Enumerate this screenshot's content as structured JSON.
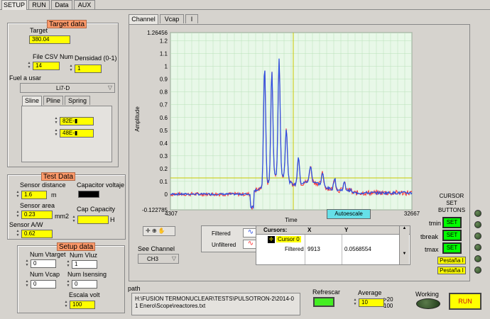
{
  "top_tabs": [
    "SETUP",
    "RUN",
    "Data",
    "AUX"
  ],
  "target": {
    "header": "Target data",
    "target_label": "Target",
    "target_value": "380.04",
    "file_label": "File CSV Num",
    "file_value": "14",
    "dens_label": "Densidad (0-1)",
    "dens_value": "1",
    "fuel_label": "Fuel a usar",
    "fuel_value": "Li7-D",
    "subtabs": [
      "Sline",
      "Pline",
      "Spring"
    ],
    "v1": "82E-▮",
    "v2": "48E-▮"
  },
  "test": {
    "header": "Test Data",
    "dist_label": "Sensor distance",
    "dist_value": "1.6",
    "dist_unit": "m",
    "cap_label": "Capacitor voltaje",
    "area_label": "Sensor area",
    "area_value": "0.23",
    "area_unit": "mm2",
    "capc_label": "Cap Capacity",
    "capc_unit": "H",
    "aw_label": "Sensor A/W",
    "aw_value": "0.62"
  },
  "setup": {
    "header": "Setup data",
    "vt_label": "Num Vtarget",
    "vt_value": "0",
    "vl_label": "Num Vluz",
    "vl_value": "1",
    "vc_label": "Num Vcap",
    "vc_value": "0",
    "is_label": "Num Isensing",
    "is_value": "0",
    "esc_label": "Escala volt",
    "esc_value": "100"
  },
  "chart_tabs": [
    "Channel",
    "Vcap",
    "I"
  ],
  "chart_data": {
    "type": "line",
    "title": "",
    "xlabel": "Time",
    "ylabel": "Amplitude",
    "xlim": [
      4307,
      32667
    ],
    "ylim": [
      -0.122785,
      1.26456
    ],
    "yticks": [
      "1.26456",
      "1.2",
      "1.1",
      "1",
      "0.9",
      "0.8",
      "0.7",
      "0.6",
      "0.5",
      "0.4",
      "0.3",
      "0.2",
      "0.1",
      "0",
      "-0.122785"
    ],
    "xticks": [
      "4307",
      "32667"
    ],
    "series": [
      {
        "name": "Filtered",
        "color": "#3050e0"
      },
      {
        "name": "Unfiltered",
        "color": "#ff3030"
      }
    ]
  },
  "autoescale": "Autoescale",
  "legend": {
    "filtered": "Filtered",
    "unfiltered": "Unfiltered"
  },
  "cursors": {
    "header": "Cursors:",
    "col_x": "X",
    "col_y": "Y",
    "name": "Cursor 0",
    "sub": "Filtered",
    "x": "9913",
    "y": "0.0568554"
  },
  "see_channel": {
    "label": "See Channel",
    "value": "CH3"
  },
  "path": {
    "label": "path",
    "value": "H:\\FUSION TERMONUCLEAR\\TESTS\\PULSOTRON-2\\2014-01 Enero\\Scope\\reactores.txt"
  },
  "refrescar": "Refrescar",
  "average": {
    "label": "Average",
    "value": "10",
    "note": ">20 100"
  },
  "working": "Working",
  "run": "RUN",
  "cursor_set": {
    "title": "CURSOR SET BUTTONS",
    "labels": [
      "tmin",
      "tbreak",
      "tmax"
    ],
    "btn": "SET"
  },
  "pestana": [
    "Pestaña I",
    "Pestaña I"
  ]
}
